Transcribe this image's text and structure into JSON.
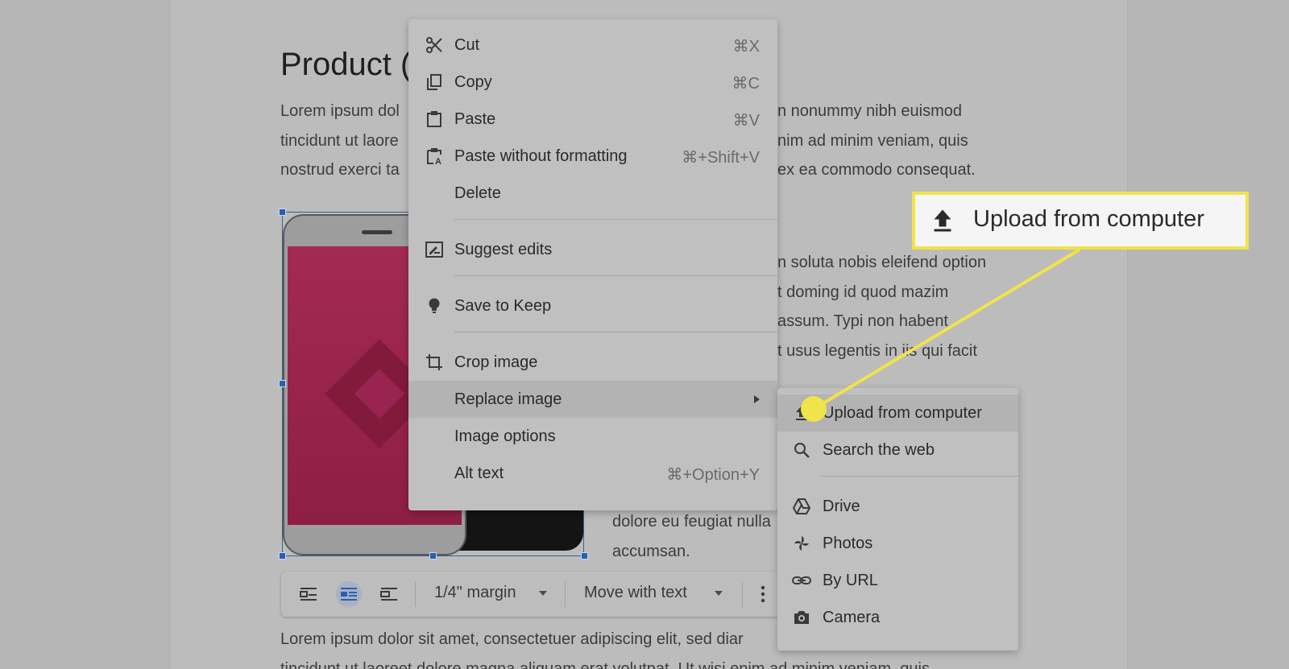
{
  "document": {
    "title": "Product (",
    "para1": {
      "left_lines": [
        "Lorem ipsum dol",
        "tincidunt ut laore",
        "nostrud exerci ta"
      ],
      "right_lines": [
        "n nonummy nibh euismod",
        "nim ad minim veniam, quis",
        "ex ea commodo consequat."
      ]
    },
    "para2": {
      "lines": [
        "n soluta nobis eleifend option",
        "t doming id quod mazim",
        "assum. Typi non habent",
        "t usus legentis in iis qui facit"
      ]
    },
    "para3": {
      "lines": [
        "dolore eu feugiat nulla",
        "accumsan."
      ]
    },
    "para4": {
      "lines": [
        "Lorem ipsum dolor sit amet, consectetuer adipiscing elit, sed diar",
        "tincidunt ut laoreet dolore magna aliquam erat volutpat. Ut wisi enim ad minim veniam, quis"
      ]
    }
  },
  "image_toolbar": {
    "margin_label": "1/4\" margin",
    "position_label": "Move with text",
    "icons": [
      "inline-icon",
      "wrap-text-icon",
      "break-text-icon",
      "more-vert-icon"
    ]
  },
  "context_menu": {
    "items": [
      {
        "label": "Cut",
        "shortcut": "⌘X",
        "icon": "scissors-icon"
      },
      {
        "label": "Copy",
        "shortcut": "⌘C",
        "icon": "copy-icon"
      },
      {
        "label": "Paste",
        "shortcut": "⌘V",
        "icon": "clipboard-icon"
      },
      {
        "label": "Paste without formatting",
        "shortcut": "⌘+Shift+V",
        "icon": "paste-plain-icon"
      },
      {
        "label": "Delete",
        "shortcut": ""
      },
      {
        "label": "Suggest edits",
        "shortcut": "",
        "icon": "suggest-edit-icon"
      },
      {
        "label": "Save to Keep",
        "shortcut": "",
        "icon": "lightbulb-icon"
      },
      {
        "label": "Crop image",
        "shortcut": "",
        "icon": "crop-icon"
      },
      {
        "label": "Replace image",
        "shortcut": "",
        "submenu": true
      },
      {
        "label": "Image options",
        "shortcut": ""
      },
      {
        "label": "Alt text",
        "shortcut": "⌘+Option+Y"
      }
    ]
  },
  "submenu": {
    "items": [
      {
        "label": "Upload from computer",
        "icon": "upload-icon"
      },
      {
        "label": "Search the web",
        "icon": "search-icon"
      },
      {
        "label": "Drive",
        "icon": "drive-icon"
      },
      {
        "label": "Photos",
        "icon": "photos-icon"
      },
      {
        "label": "By URL",
        "icon": "link-icon"
      },
      {
        "label": "Camera",
        "icon": "camera-icon"
      }
    ]
  },
  "callout": {
    "label": "Upload from computer",
    "icon": "upload-icon",
    "color": "#f1e34a"
  },
  "colors": {
    "accent_handle": "#2a5fb0",
    "phone_screen": "#a32a52",
    "highlight_yellow": "#f1e34a"
  }
}
